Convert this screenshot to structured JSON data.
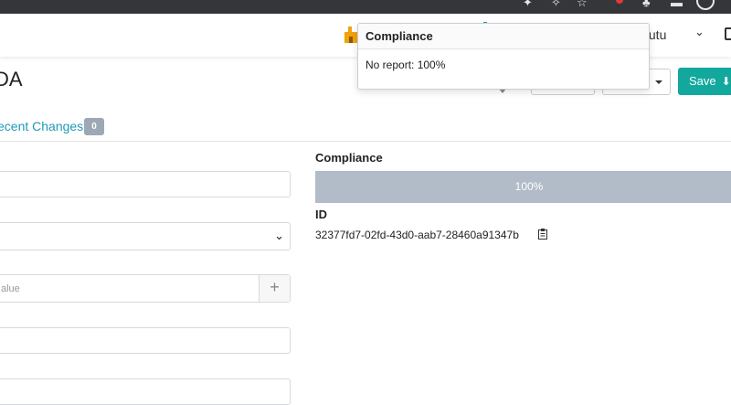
{
  "navbar": {
    "user_name": "tutu"
  },
  "page": {
    "title": "DA"
  },
  "header_buttons": {
    "save_label": "Save"
  },
  "tabs": {
    "recent_changes_label": "ecent Changes",
    "recent_changes_count": "0"
  },
  "form": {
    "value_placeholder": "alue"
  },
  "details": {
    "compliance_label": "Compliance",
    "compliance_value": "100%",
    "id_label": "ID",
    "id_value": "32377fd7-02fd-43d0-aab7-28460a91347b"
  },
  "popover": {
    "title": "Compliance",
    "body": "No report: 100%"
  },
  "colors": {
    "accent": "#13a89e",
    "link": "#1e9ab7",
    "compliance_bar": "#b2bcc8",
    "badge": "#9ca8b5"
  },
  "icons": {
    "rudder_logo": "rudder-icon",
    "user_dropdown": "chevron-down-icon",
    "save_download": "download-icon",
    "copy_id": "clipboard-icon",
    "add_value": "plus-icon"
  }
}
